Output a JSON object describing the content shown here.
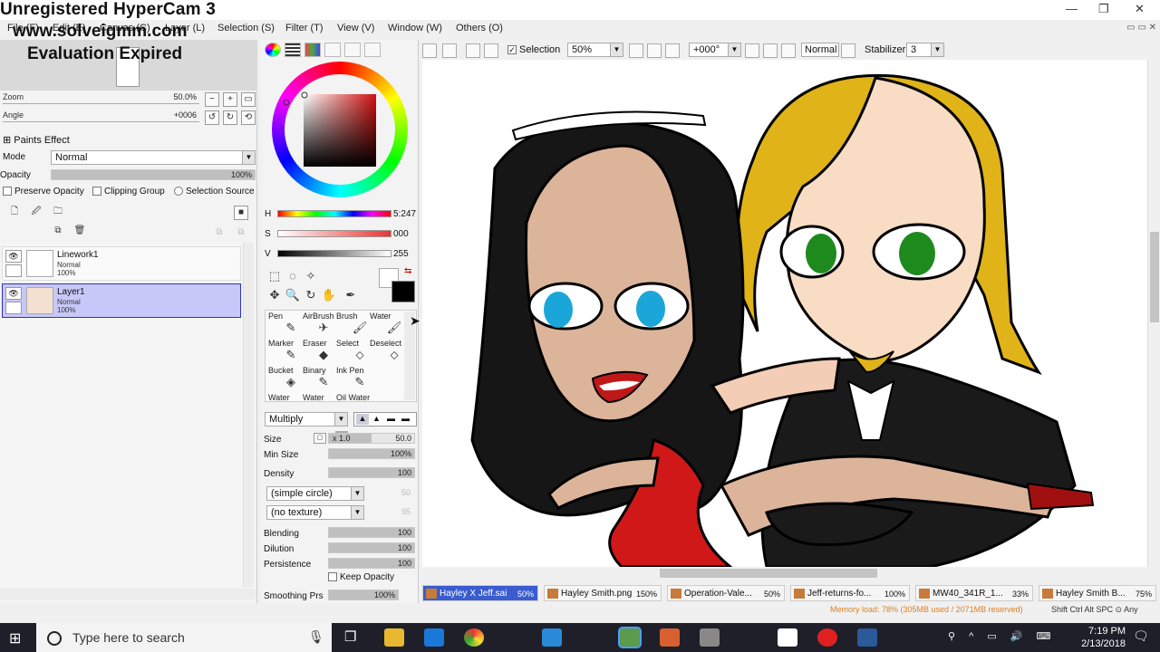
{
  "overlay": {
    "line1": "Unregistered HyperCam 3",
    "line2": "www.solveigmm.com",
    "line3": "Evaluation Expired"
  },
  "menu": {
    "items": [
      "File (F)",
      "Edit (E)",
      "Canvas (C)",
      "Layer (L)",
      "Selection (S)",
      "Filter (T)",
      "View (V)",
      "Window (W)",
      "Others (O)"
    ]
  },
  "navigator": {
    "zoom_label": "Zoom",
    "zoom_value": "50.0%",
    "zoom_fill": 0.5,
    "angle_label": "Angle",
    "angle_value": "+0006"
  },
  "paints_effect": {
    "title": "Paints Effect",
    "mode_label": "Mode",
    "mode_value": "Normal",
    "opacity_label": "Opacity",
    "opacity_value": "100%",
    "preserve_opacity": "Preserve Opacity",
    "clipping_group": "Clipping Group",
    "selection_source": "Selection Source"
  },
  "layers": [
    {
      "name": "Linework1",
      "mode": "Normal",
      "opacity": "100%",
      "selected": false
    },
    {
      "name": "Layer1",
      "mode": "Normal",
      "opacity": "100%",
      "selected": true
    }
  ],
  "color": {
    "h_label": "H",
    "h_value": "5:247",
    "s_label": "S",
    "s_value": "000",
    "v_label": "V",
    "v_value": "255",
    "primary": "#000000",
    "secondary": "#ffffff"
  },
  "brushes": {
    "row1": [
      "Pen",
      "AirBrush",
      "Brush",
      "Water"
    ],
    "row2": [
      "Marker",
      "Eraser",
      "Select",
      "Deselect"
    ],
    "row3": [
      "Bucket",
      "Binary",
      "Ink Pen"
    ],
    "row4": [
      "Water",
      "Water",
      "Oil Water"
    ]
  },
  "brush_props": {
    "blend_mode": "Multiply",
    "size_label": "Size",
    "size_mult": "x 1.0",
    "size_value": "50.0",
    "min_size_label": "Min Size",
    "min_size_value": "100%",
    "density_label": "Density",
    "density_value": "100",
    "shape": "(simple circle)",
    "shape_val": "50",
    "texture": "(no texture)",
    "texture_val": "95",
    "blending_label": "Blending",
    "blending_value": "100",
    "dilution_label": "Dilution",
    "dilution_value": "100",
    "persistence_label": "Persistence",
    "persistence_value": "100",
    "keep_opacity": "Keep Opacity",
    "smoothing_label": "Smoothing Prs",
    "smoothing_value": "100%"
  },
  "toolbar": {
    "selection_label": "Selection",
    "zoom_value": "50%",
    "angle_value": "+000°",
    "blend_mode": "Normal",
    "stabilizer_label": "Stabilizer",
    "stabilizer_value": "3"
  },
  "doc_tabs": [
    {
      "name": "Hayley X Jeff.sai",
      "pct": "50%",
      "active": true
    },
    {
      "name": "Hayley Smith.png",
      "pct": "150%",
      "active": false
    },
    {
      "name": "Operation-Vale...",
      "pct": "50%",
      "active": false
    },
    {
      "name": "Jeff-returns-fo...",
      "pct": "100%",
      "active": false
    },
    {
      "name": "MW40_341R_1...",
      "pct": "33%",
      "active": false
    },
    {
      "name": "Hayley Smith B...",
      "pct": "75%",
      "active": false
    }
  ],
  "status": {
    "memory": "Memory load: 78% (305MB used / 2071MB reserved)",
    "keys": "Shift Ctrl Alt SPC ⊙ Any"
  },
  "taskbar": {
    "search_placeholder": "Type here to search",
    "time": "7:19 PM",
    "date": "2/13/2018"
  }
}
